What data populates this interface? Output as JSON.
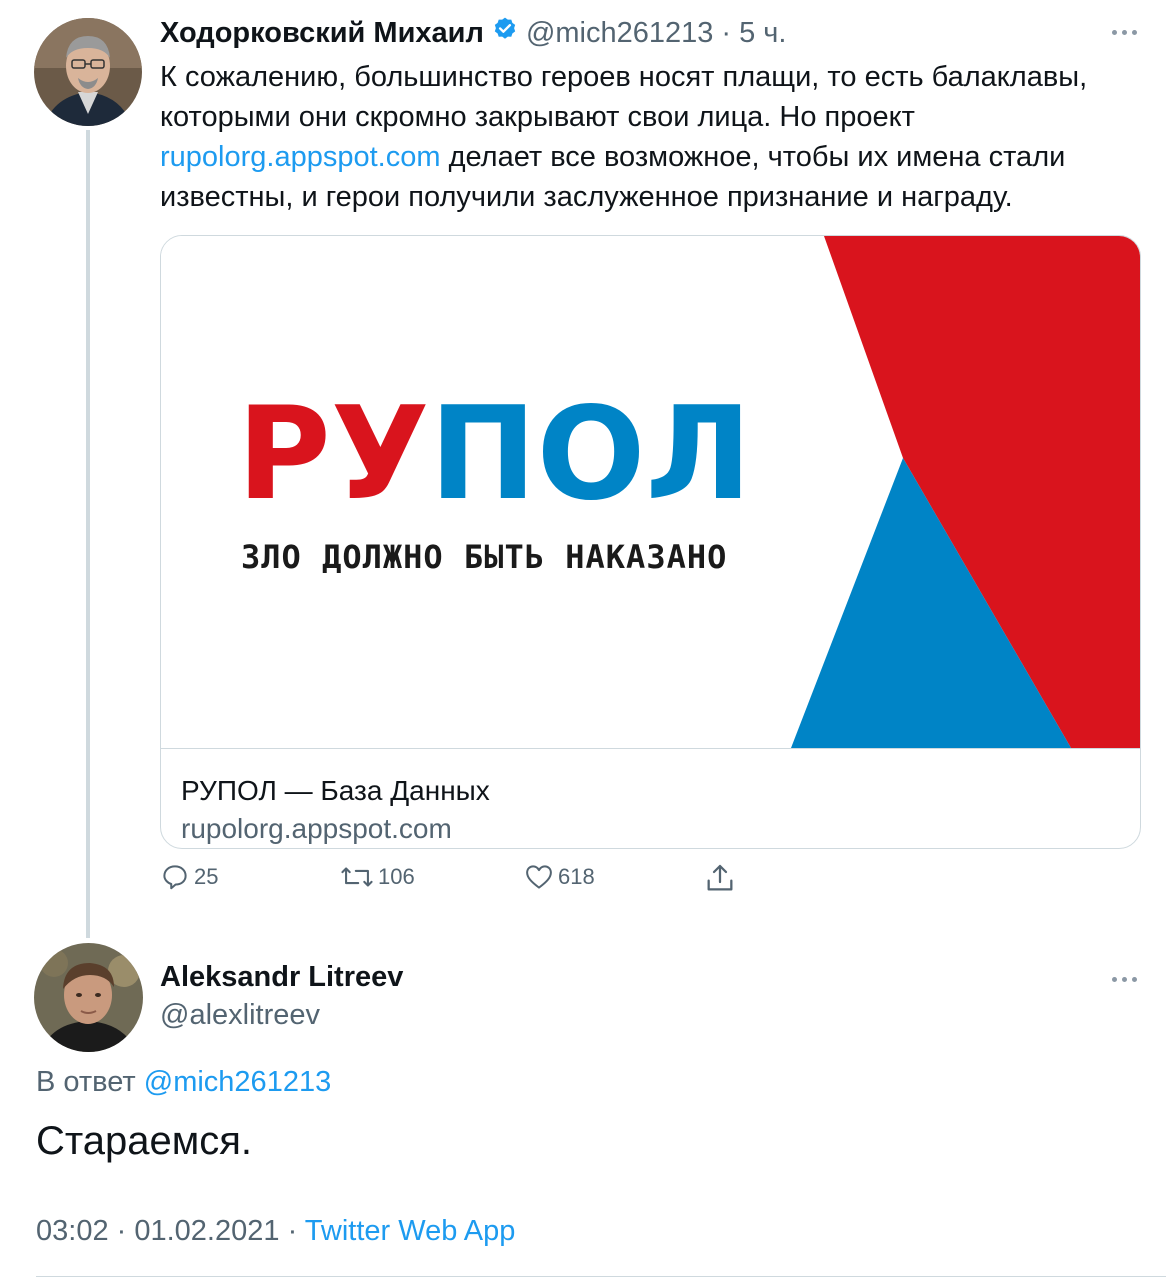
{
  "parent_tweet": {
    "author_name": "Ходорковский Михаил",
    "author_handle": "@mich261213",
    "time": "5 ч.",
    "text_before_link": "К сожалению, большинство героев носят плащи, то есть балаклавы, которыми они скромно закрывают свои лица. Но проект",
    "link_text": "rupolorg.appspot.com",
    "text_after_link": "делает все возможное, чтобы их имена стали известны, и герои получили заслуженное признание и награду.",
    "card": {
      "logo_part1": "РУ",
      "logo_part2": "ПОЛ",
      "slogan": "ЗЛО ДОЛЖНО БЫТЬ НАКАЗАНО",
      "title": "РУПОЛ — База Данных",
      "domain": "rupolorg.appspot.com"
    },
    "actions": {
      "reply_count": "25",
      "retweet_count": "106",
      "like_count": "618"
    }
  },
  "main_tweet": {
    "author_name": "Aleksandr Litreev",
    "author_handle": "@alexlitreev",
    "reply_to_label": "В ответ",
    "reply_to_handle": "@mich261213",
    "text": "Стараемся.",
    "time": "03:02",
    "date": "01.02.2021",
    "source": "Twitter Web App"
  },
  "colors": {
    "link": "#1d9bf0",
    "verified": "#1d9bf0",
    "rupol_red": "#d9141d",
    "rupol_blue": "#0084c6"
  }
}
